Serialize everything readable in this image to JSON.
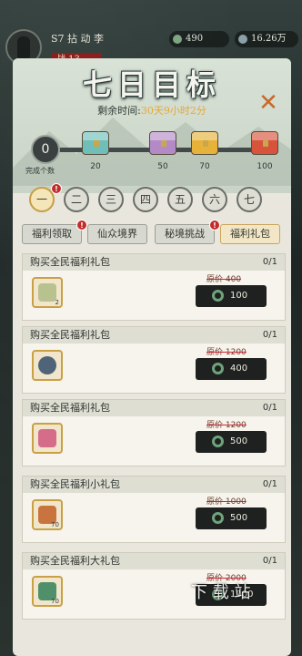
{
  "topbar": {
    "server": "S7 拈 动 李",
    "level": "战 13",
    "resource_1": "490",
    "resource_2": "16.26万"
  },
  "panel": {
    "title": "七日目标",
    "remaining_label": "剩余时间:",
    "remaining_value": "30天9小时2分",
    "progress_value": "0",
    "progress_label": "完成个数"
  },
  "chests": [
    {
      "value": "20",
      "color": "#6fbfb8"
    },
    {
      "value": "50",
      "color": "#b48ac6"
    },
    {
      "value": "70",
      "color": "#e7b23a"
    },
    {
      "value": "100",
      "color": "#d8533b"
    }
  ],
  "days": [
    "一",
    "二",
    "三",
    "四",
    "五",
    "六",
    "七"
  ],
  "tabs": [
    "福利领取",
    "仙众境界",
    "秘境挑战",
    "福利礼包"
  ],
  "items": [
    {
      "title": "购买全民福利礼包",
      "count": "0/1",
      "orig": "原价 400",
      "price": "100",
      "icon_count": "2",
      "icon_color": "#b8c28f"
    },
    {
      "title": "购买全民福利礼包",
      "count": "0/1",
      "orig": "原价 1200",
      "price": "400",
      "icon_count": "",
      "icon_color": "#4f6478"
    },
    {
      "title": "购买全民福利礼包",
      "count": "0/1",
      "orig": "原价 1200",
      "price": "500",
      "icon_count": "",
      "icon_color": "#d46c8a"
    },
    {
      "title": "购买全民福利小礼包",
      "count": "0/1",
      "orig": "原价 1000",
      "price": "500",
      "icon_count": "70",
      "icon_color": "#c9743f"
    },
    {
      "title": "购买全民福利大礼包",
      "count": "0/1",
      "orig": "原价 2000",
      "price": "1000",
      "icon_count": "70",
      "icon_color": "#4f8f6a"
    }
  ],
  "watermark": "下 载 站"
}
